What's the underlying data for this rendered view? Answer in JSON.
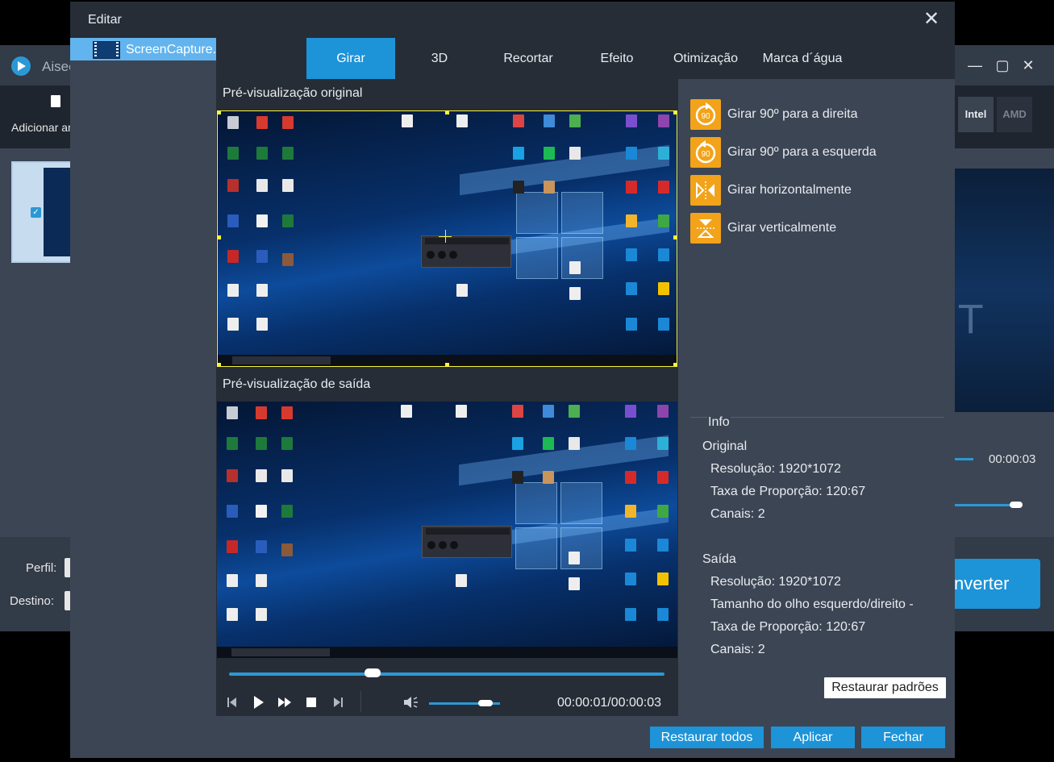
{
  "background_app": {
    "app_name": "Aisee",
    "add_files_label": "Adicionar ar",
    "perfil_label": "Perfil:",
    "destino_label": "Destino:",
    "time": "00:00:03",
    "convert_label": "nverter",
    "hw_chips": [
      "Intel",
      "AMD"
    ]
  },
  "dialog": {
    "title": "Editar",
    "close_icon": "close-icon",
    "file_item": "ScreenCapture.",
    "tabs": [
      "Girar",
      "3D",
      "Recortar",
      "Efeito",
      "Otimização",
      "Marca d´água"
    ],
    "active_tab": "Girar",
    "original_preview_label": "Pré-visualização original",
    "output_preview_label": "Pré-visualização de saída",
    "player": {
      "time": "00:00:01/00:00:03",
      "seek_fraction": 0.33,
      "volume_fraction": 0.8
    },
    "rotate_options": [
      {
        "label": "Girar 90º para a direita",
        "icon": "rotate-right-icon"
      },
      {
        "label": "Girar 90º para a esquerda",
        "icon": "rotate-left-icon"
      },
      {
        "label": "Girar horizontalmente",
        "icon": "flip-horizontal-icon"
      },
      {
        "label": "Girar verticalmente",
        "icon": "flip-vertical-icon"
      }
    ],
    "info": {
      "title": "Info",
      "original_heading": "Original",
      "original": {
        "resolution": "Resolução: 1920*1072",
        "aspect": "Taxa de Proporção: 120:67",
        "channels": "Canais: 2"
      },
      "output_heading": "Saída",
      "output": {
        "resolution": "Resolução: 1920*1072",
        "eye_size": "Tamanho do olho esquerdo/direito -",
        "aspect": "Taxa de Proporção: 120:67",
        "channels": "Canais: 2"
      }
    },
    "restore_defaults": "Restaurar padrões",
    "buttons": {
      "restore_all": "Restaurar todos",
      "apply": "Aplicar",
      "close": "Fechar"
    }
  },
  "colors": {
    "accent": "#1d93d8",
    "icon_orange": "#f2a31a",
    "selection_yellow": "#f7f43b"
  }
}
